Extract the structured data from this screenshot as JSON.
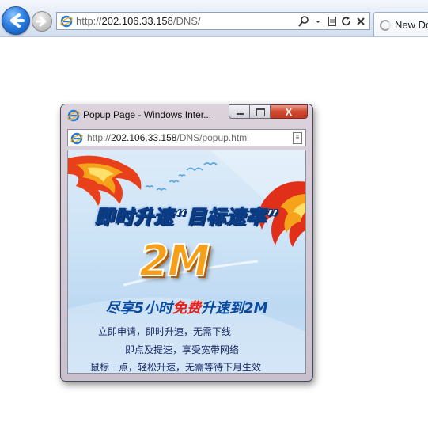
{
  "browser": {
    "address_prefix": "http://",
    "address_host": "202.106.33.158",
    "address_path": "/DNS/",
    "tab_label": "New Do"
  },
  "popup": {
    "title": "Popup Page - Windows Inter...",
    "close_label": "X",
    "address_prefix": "http://",
    "address_host": "202.106.33.158",
    "address_path": "/DNS/popup.html",
    "ad": {
      "headline": "即时升速“目标速率”",
      "speed": "2M",
      "sub_pre": "尽享5小时",
      "sub_free": "免费",
      "sub_post": "升速到2M",
      "line1": "立即申请，即时升速，无需下线",
      "line2": "即点及提速，享受宽带网络",
      "line3": "鼠标一点，轻松升速，无需等待下月生效"
    }
  },
  "colors": {
    "accent_blue": "#0b4a9e",
    "free_red": "#e3201b",
    "speed_orange": "#f6a01a"
  },
  "icons": [
    "back-arrow-icon",
    "forward-arrow-icon",
    "ie-logo-icon",
    "search-icon",
    "dropdown-icon",
    "compat-view-icon",
    "refresh-icon",
    "stop-icon",
    "loading-spinner-icon",
    "minimize-icon",
    "maximize-icon",
    "close-icon"
  ]
}
